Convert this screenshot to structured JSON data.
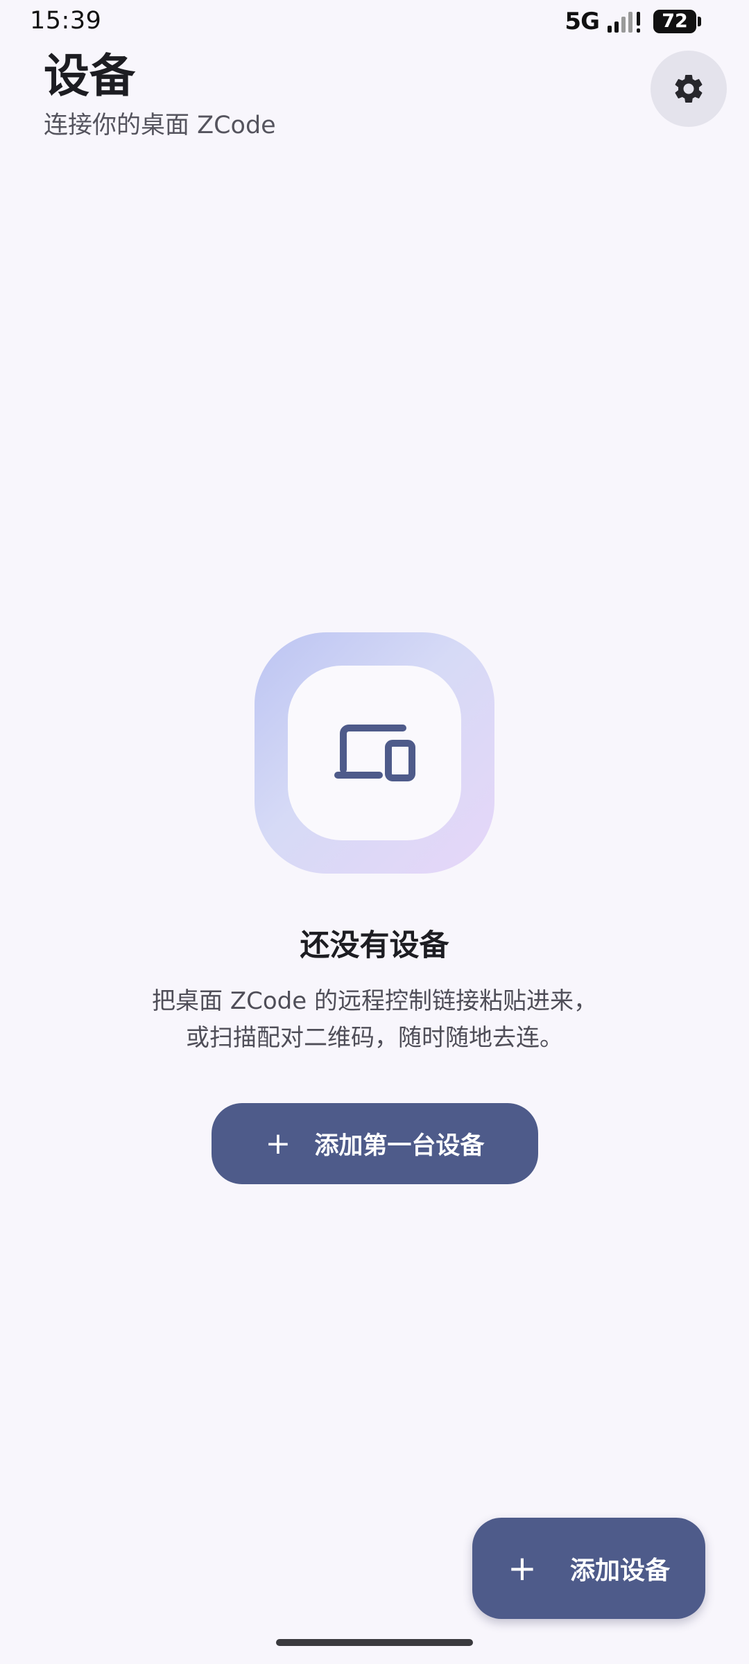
{
  "status_bar": {
    "time": "15:39",
    "network": "5G",
    "battery": "72"
  },
  "header": {
    "title": "设备",
    "subtitle": "连接你的桌面 ZCode",
    "settings_icon": "gear-icon"
  },
  "empty_state": {
    "icon": "devices-icon",
    "title": "还没有设备",
    "description_lines": [
      "把桌面 ZCode 的远程控制链接粘贴进来，",
      "或扫描配对二维码，随时随地去连。"
    ],
    "button_label": "添加第一台设备"
  },
  "fab": {
    "label": "添加设备"
  },
  "colors": {
    "background": "#f8f6fc",
    "primary_button": "#4e5b8a",
    "settings_button_bg": "#e4e3ec"
  }
}
